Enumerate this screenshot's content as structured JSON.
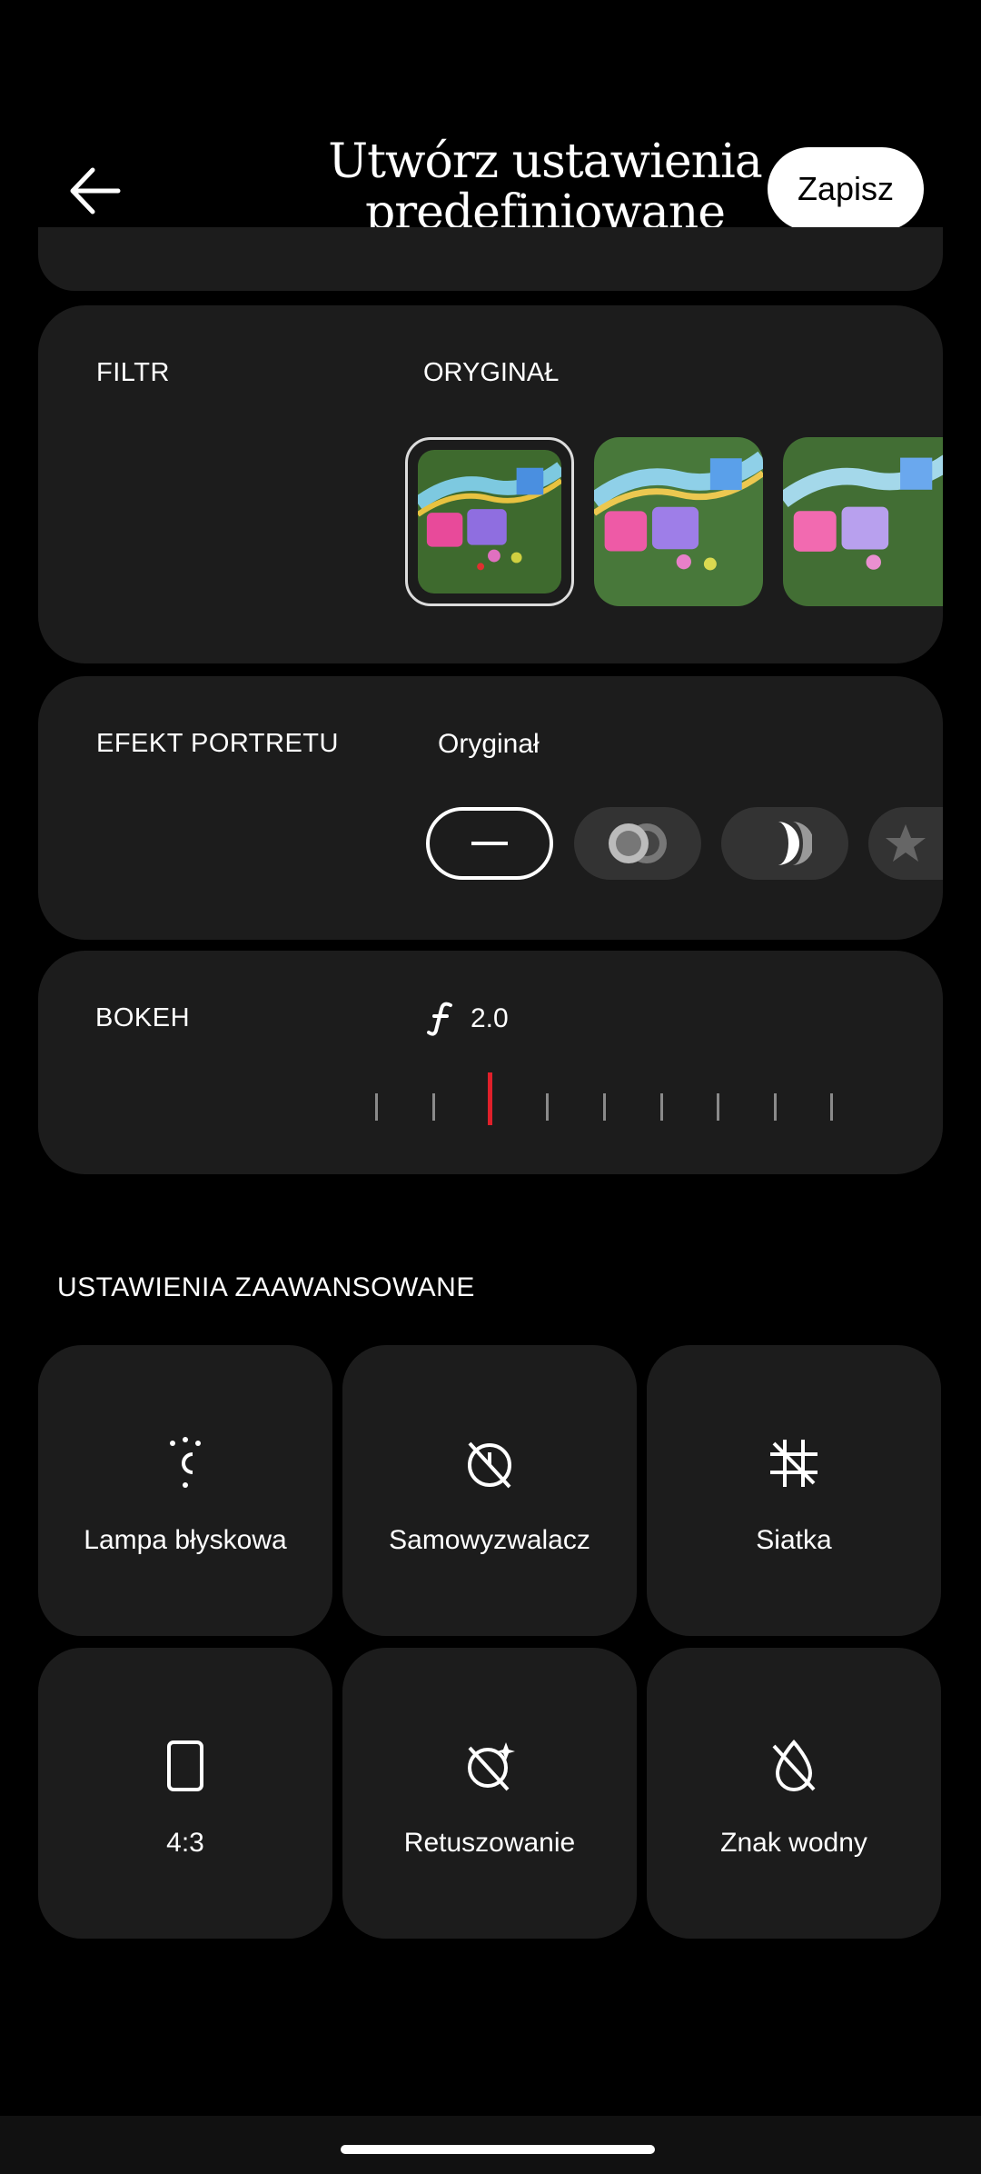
{
  "header": {
    "title_line1": "Utwórz ustawienia",
    "title_line2": "predefiniowane",
    "save_label": "Zapisz",
    "back_icon": "arrow-left-icon"
  },
  "filter": {
    "label": "FILTR",
    "selected_value": "ORYGINAŁ",
    "thumbnails": [
      "thumbnail-original",
      "thumbnail-filter-2",
      "thumbnail-filter-3"
    ]
  },
  "portrait": {
    "label": "EFEKT PORTRETU",
    "selected_value": "Oryginał",
    "options": [
      "none-icon",
      "blur-icon",
      "spin-blur-icon",
      "star-icon"
    ]
  },
  "bokeh": {
    "label": "BOKEH",
    "aperture_icon": "f-number-icon",
    "value": "2.0",
    "tick_count": 9,
    "active_tick_index": 2
  },
  "advanced": {
    "title": "USTAWIENIA ZAAWANSOWANE",
    "tiles": [
      {
        "label": "Lampa błyskowa",
        "icon": "flash-auto-icon"
      },
      {
        "label": "Samowyzwalacz",
        "icon": "timer-off-icon"
      },
      {
        "label": "Siatka",
        "icon": "grid-off-icon"
      },
      {
        "label": "4:3",
        "icon": "aspect-ratio-icon"
      },
      {
        "label": "Retuszowanie",
        "icon": "retouch-off-icon"
      },
      {
        "label": "Znak wodny",
        "icon": "watermark-off-icon"
      }
    ]
  },
  "colors": {
    "background": "#000000",
    "card": "#1c1c1c",
    "accent_tick": "#e0202a",
    "save_button": "#ffffff"
  }
}
